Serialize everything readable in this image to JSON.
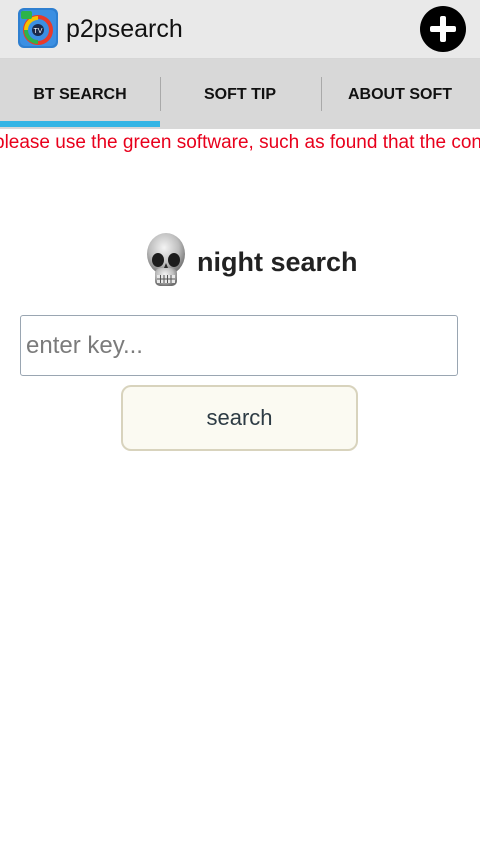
{
  "app": {
    "title": "p2psearch",
    "icon": "app-logo-icon",
    "add_icon": "plus-circle-icon"
  },
  "tabs": [
    {
      "label": "BT SEARCH",
      "active": true
    },
    {
      "label": "SOFT TIP",
      "active": false
    },
    {
      "label": "ABOUT SOFT",
      "active": false
    }
  ],
  "notice": {
    "text": "please use the green software, such as found that the contents",
    "color": "#e8001c"
  },
  "search": {
    "heading": "night search",
    "heading_icon": "skull-icon",
    "placeholder": "enter key...",
    "value": "",
    "button_label": "search"
  },
  "colors": {
    "accent": "#33b5e5",
    "action_bar": "#e9e9e9",
    "tab_bar": "#d8d8d8"
  }
}
